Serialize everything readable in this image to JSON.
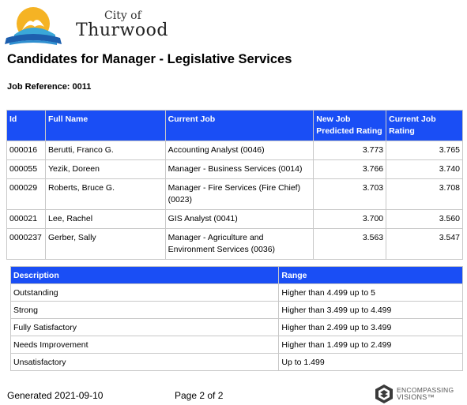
{
  "header": {
    "city_of": "City of",
    "city_name": "Thurwood"
  },
  "report": {
    "title": "Candidates for Manager - Legislative Services",
    "job_reference": "Job Reference: 0011"
  },
  "candidates": {
    "columns": [
      "Id",
      "Full Name",
      "Current Job",
      "New Job Predicted Rating",
      "Current Job Rating"
    ],
    "rows": [
      {
        "id": "000016",
        "name": "Berutti, Franco G.",
        "job": "Accounting Analyst (0046)",
        "predicted": "3.773",
        "current": "3.765"
      },
      {
        "id": "000055",
        "name": "Yezik, Doreen",
        "job": "Manager - Business Services (0014)",
        "predicted": "3.766",
        "current": "3.740"
      },
      {
        "id": "000029",
        "name": "Roberts, Bruce G.",
        "job": "Manager - Fire Services (Fire Chief) (0023)",
        "predicted": "3.703",
        "current": "3.708"
      },
      {
        "id": "000021",
        "name": "Lee, Rachel",
        "job": "GIS Analyst (0041)",
        "predicted": "3.700",
        "current": "3.560"
      },
      {
        "id": "0000237",
        "name": "Gerber, Sally",
        "job": "Manager - Agriculture and Environment Services (0036)",
        "predicted": "3.563",
        "current": "3.547"
      }
    ]
  },
  "ranges": {
    "columns": [
      "Description",
      "Range"
    ],
    "rows": [
      {
        "description": "Outstanding",
        "range": "Higher than 4.499 up to 5"
      },
      {
        "description": "Strong",
        "range": "Higher than 3.499 up to 4.499"
      },
      {
        "description": "Fully Satisfactory",
        "range": "Higher than 2.499 up to 3.499"
      },
      {
        "description": "Needs Improvement",
        "range": "Higher than 1.499 up to 2.499"
      },
      {
        "description": "Unsatisfactory",
        "range": "Up to 1.499"
      }
    ]
  },
  "footer": {
    "generated": "Generated 2021-09-10",
    "page": "Page 2 of 2",
    "brand_line1": "ENCOMPASSING",
    "brand_line2": "VISIONS™"
  },
  "colors": {
    "header_blue": "#1a4ef5",
    "border": "#c8c8c8"
  }
}
